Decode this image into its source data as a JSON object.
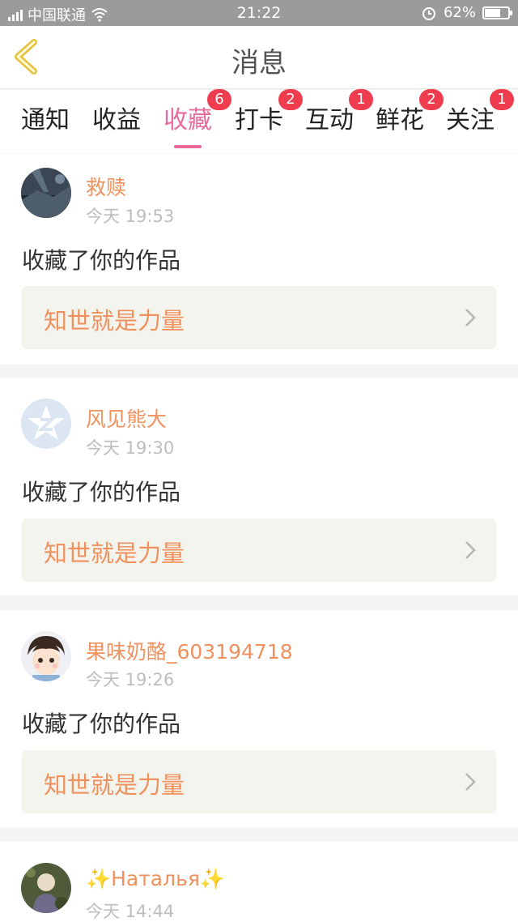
{
  "status_bar": {
    "carrier": "中国联通",
    "time": "21:22",
    "battery": "62%",
    "battery_level": 0.62,
    "icons": [
      "signal-icon",
      "wifi-icon",
      "alarm-icon",
      "battery-icon"
    ]
  },
  "header": {
    "title": "消息",
    "back_icon": "chevron-left-icon"
  },
  "tabs": [
    {
      "label": "通知",
      "badge": ""
    },
    {
      "label": "收益",
      "badge": ""
    },
    {
      "label": "收藏",
      "badge": "6",
      "active": true
    },
    {
      "label": "打卡",
      "badge": "2"
    },
    {
      "label": "互动",
      "badge": "1"
    },
    {
      "label": "鲜花",
      "badge": "2"
    },
    {
      "label": "关注",
      "badge": "1"
    }
  ],
  "messages": [
    {
      "name": "救赎",
      "time": "今天 19:53",
      "action": "收藏了你的作品",
      "work": "知世就是力量"
    },
    {
      "name": "风见熊大",
      "time": "今天 19:30",
      "action": "收藏了你的作品",
      "work": "知世就是力量"
    },
    {
      "name": "果味奶酪_603194718",
      "time": "今天 19:26",
      "action": "收藏了你的作品",
      "work": "知世就是力量"
    },
    {
      "name": "✨Наталья✨",
      "time": "今天 14:44",
      "action": "",
      "work": ""
    }
  ],
  "colors": {
    "accent": "#ea6a9a",
    "name": "#f0915d",
    "badge": "#f03c4f",
    "status_bar": "#9b9b9b"
  }
}
